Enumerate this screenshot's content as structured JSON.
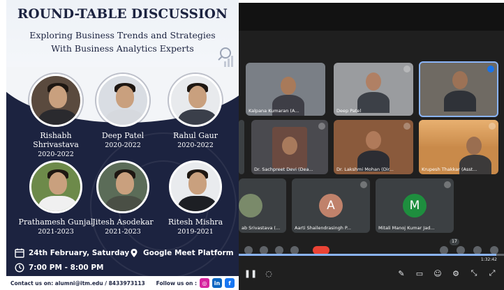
{
  "poster": {
    "title": "ROUND-TABLE DISCUSSION",
    "subtitle_line1": "Exploring Business Trends and Strategies",
    "subtitle_line2": "With Business Analytics Experts",
    "speakers": [
      {
        "name": "Rishabh Shrivastava",
        "years": "2020-2022"
      },
      {
        "name": "Deep Patel",
        "years": "2020-2022"
      },
      {
        "name": "Rahul Gaur",
        "years": "2020-2022"
      },
      {
        "name": "Prathamesh Gunjal",
        "years": "2021-2023"
      },
      {
        "name": "Jitesh Asodekar",
        "years": "2021-2023"
      },
      {
        "name": "Ritesh Mishra",
        "years": "2019-2021"
      }
    ],
    "date": "24th February, Saturday",
    "venue": "Google Meet Platform",
    "time": "7:00 PM - 8:00 PM",
    "contact": "Contact us on: alumni@itm.edu / 8433973113",
    "follow": "Follow us on :",
    "social": {
      "instagram": "◎",
      "linkedin": "in",
      "facebook": "f"
    },
    "colors": {
      "navy": "#1c2340",
      "instagram": "#d6249f",
      "linkedin": "#0a66c2",
      "facebook": "#1877f2"
    }
  },
  "meet": {
    "tiles": [
      {
        "label": "Kalpana Kumaran (A..."
      },
      {
        "label": "Deep Patel"
      },
      {
        "label": ""
      },
      {
        "label": "Dr. Sachpreet Devi (Dea..."
      },
      {
        "label": "Dr. Lakshmi Mohan (Dir..."
      },
      {
        "label": "Krupesh Thakkar (Asst..."
      },
      {
        "label": "ab Srivastava (..."
      },
      {
        "label": "Aarti Shailendrasingh P..."
      },
      {
        "label": "Mitali Manoj Kumar Jad..."
      }
    ],
    "avatars": [
      {
        "letter": "A",
        "color": "#c0826b"
      },
      {
        "letter": "M",
        "color": "#1e8e3e"
      }
    ],
    "participant_count": "17",
    "elapsed": "1:32:42",
    "progress_fraction": 0.97,
    "colors": {
      "end_call": "#ea4335",
      "active_border": "#8ab4f8"
    }
  }
}
